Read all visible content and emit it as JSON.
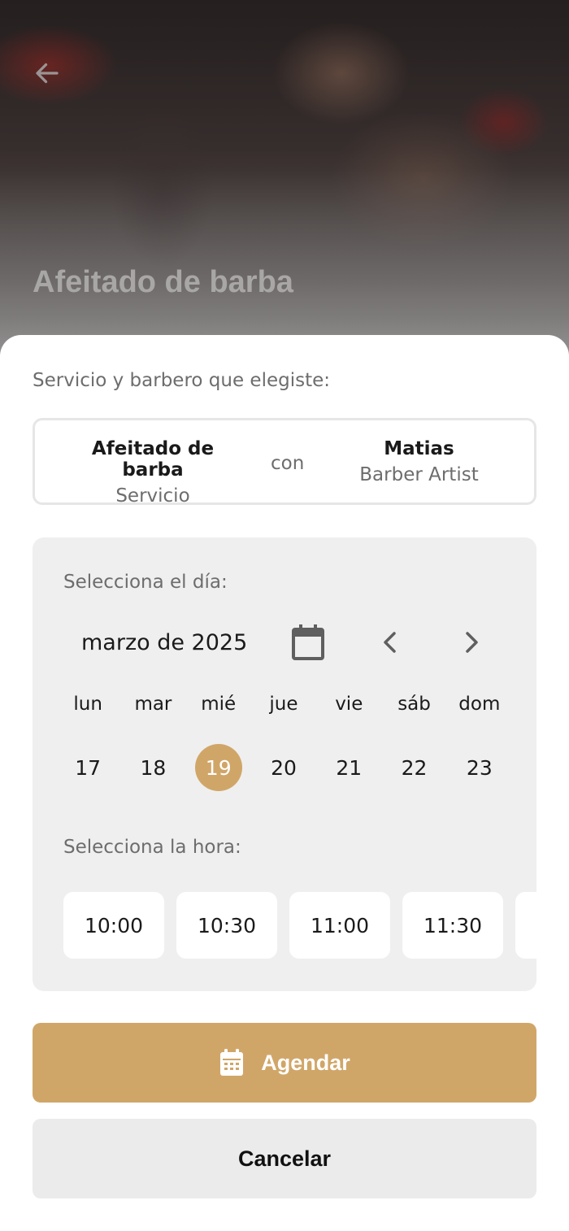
{
  "hero": {
    "title": "Afeitado de barba",
    "back_icon": "arrow-left-icon"
  },
  "summary": {
    "label": "Servicio y barbero que elegiste:",
    "service_name": "Afeitado de barba",
    "service_caption": "Servicio",
    "connector": "con",
    "barber_name": "Matias",
    "barber_caption": "Barber Artist"
  },
  "date_picker": {
    "label": "Selecciona el día:",
    "month": "marzo de 2025",
    "calendar_icon": "calendar-icon",
    "prev_icon": "chevron-left-icon",
    "next_icon": "chevron-right-icon",
    "weekdays": [
      "lun",
      "mar",
      "mié",
      "jue",
      "vie",
      "sáb",
      "dom"
    ],
    "dates": [
      "17",
      "18",
      "19",
      "20",
      "21",
      "22",
      "23"
    ],
    "selected_date": "19"
  },
  "time_picker": {
    "label": "Selecciona la hora:",
    "slots": [
      "10:00",
      "10:30",
      "11:00",
      "11:30",
      ""
    ]
  },
  "actions": {
    "schedule_label": "Agendar",
    "schedule_icon": "calendar-grid-icon",
    "cancel_label": "Cancelar"
  },
  "colors": {
    "accent": "#d0a668",
    "panel_bg": "#efefef",
    "secondary_button": "#ebebeb"
  }
}
